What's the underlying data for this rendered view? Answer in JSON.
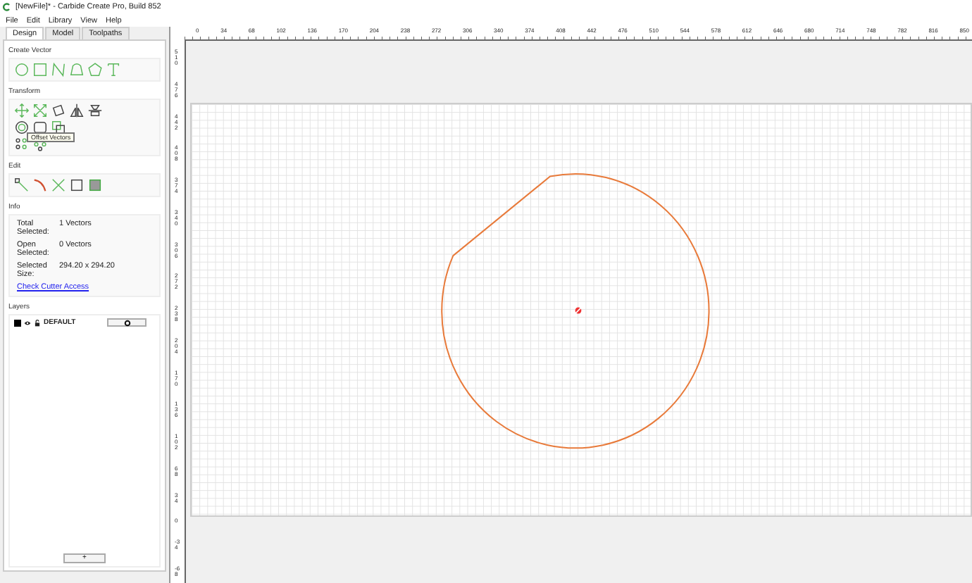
{
  "window": {
    "title": "[NewFile]* - Carbide Create Pro, Build 852"
  },
  "menu": [
    "File",
    "Edit",
    "Library",
    "View",
    "Help"
  ],
  "tabs": [
    {
      "label": "Design",
      "selected": true
    },
    {
      "label": "Model",
      "selected": false
    },
    {
      "label": "Toolpaths",
      "selected": false
    }
  ],
  "create_vector": {
    "title": "Create Vector"
  },
  "transform": {
    "title": "Transform",
    "tooltip": "Offset Vectors"
  },
  "edit": {
    "title": "Edit"
  },
  "info": {
    "title": "Info",
    "rows": [
      {
        "label": "Total Selected:",
        "value": "1 Vectors"
      },
      {
        "label": "Open Selected:",
        "value": "0 Vectors"
      },
      {
        "label": "Selected Size:",
        "value": "294.20 x 294.20"
      }
    ],
    "link": "Check Cutter Access"
  },
  "layers": {
    "title": "Layers",
    "items": [
      {
        "name": "DEFAULT",
        "color": "#000000"
      }
    ],
    "add_button": "+"
  },
  "rulers": {
    "horizontal": [
      "0",
      "34",
      "68",
      "102",
      "136",
      "170",
      "204",
      "238",
      "272",
      "306",
      "340",
      "374",
      "408",
      "442",
      "476",
      "510",
      "544",
      "578",
      "612",
      "646",
      "680",
      "714",
      "748",
      "782",
      "816",
      "850"
    ],
    "vertical": [
      "510",
      "476",
      "442",
      "408",
      "374",
      "340",
      "306",
      "272",
      "238",
      "204",
      "170",
      "136",
      "102",
      "68",
      "34",
      "0",
      "-34",
      "-68"
    ]
  }
}
